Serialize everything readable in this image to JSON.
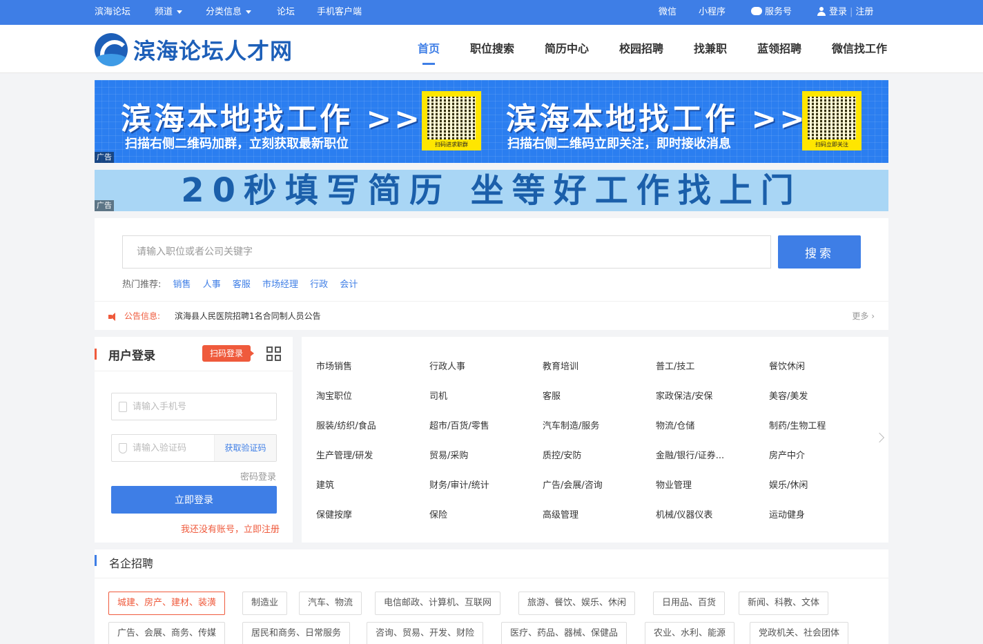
{
  "topbar": {
    "left": [
      "滨海论坛",
      "频道",
      "分类信息",
      "论坛",
      "手机客户端"
    ],
    "wechat": "微信",
    "miniprogram": "小程序",
    "service": "服务号",
    "login": "登录",
    "separator": "|",
    "register": "注册"
  },
  "header": {
    "logo_text": "滨海论坛人才网",
    "nav": [
      "首页",
      "职位搜索",
      "简历中心",
      "校园招聘",
      "找兼职",
      "蓝领招聘",
      "微信找工作"
    ],
    "active_nav": "首页"
  },
  "banner1": {
    "left_title": "滨海本地找工作 >>>",
    "left_sub": "扫描右侧二维码加群，立刻获取最新职位",
    "left_qr_caption": "扫码进求职群",
    "right_title": "滨海本地找工作 >>>",
    "right_sub": "扫描右侧二维码立即关注，即时接收消息",
    "right_qr_caption": "扫码立即关注",
    "ad_tag": "广告"
  },
  "banner2": {
    "text": "20秒填写简历  坐等好工作找上门",
    "ad_tag": "广告"
  },
  "search": {
    "placeholder": "请输入职位或者公司关键字",
    "button": "搜索",
    "hot_label": "热门推荐:",
    "hot": [
      "销售",
      "人事",
      "客服",
      "市场经理",
      "行政",
      "会计"
    ]
  },
  "notice": {
    "label": "公告信息:",
    "text": "滨海县人民医院招聘1名合同制人员公告",
    "more": "更多 ›"
  },
  "login": {
    "title": "用户登录",
    "scan": "扫码登录",
    "phone_placeholder": "请输入手机号",
    "code_placeholder": "请输入验证码",
    "get_code": "获取验证码",
    "password_login": "密码登录",
    "submit": "立即登录",
    "register_link": "我还没有账号，立即注册"
  },
  "categories": [
    [
      "市场销售",
      "行政人事",
      "教育培训",
      "普工/技工",
      "餐饮休闲"
    ],
    [
      "淘宝职位",
      "司机",
      "客服",
      "家政保洁/安保",
      "美容/美发"
    ],
    [
      "服装/纺织/食品",
      "超市/百货/零售",
      "汽车制造/服务",
      "物流/仓储",
      "制药/生物工程"
    ],
    [
      "生产管理/研发",
      "贸易/采购",
      "质控/安防",
      "金融/银行/证券...",
      "房产中介"
    ],
    [
      "建筑",
      "财务/审计/统计",
      "广告/会展/咨询",
      "物业管理",
      "娱乐/休闲"
    ],
    [
      "保健按摩",
      "保险",
      "高级管理",
      "机械/仪器仪表",
      "运动健身"
    ]
  ],
  "companies": {
    "title": "名企招聘",
    "row1": [
      "城建、房产、建材、装潢",
      "制造业",
      "汽车、物流",
      "电信邮政、计算机、互联网",
      "旅游、餐饮、娱乐、休闲",
      "日用品、百货",
      "新闻、科教、文体"
    ],
    "row2": [
      "广告、会展、商务、传媒",
      "居民和商务、日常服务",
      "咨询、贸易、开发、财险",
      "医疗、药品、器械、保健品",
      "农业、水利、能源",
      "党政机关、社会团体"
    ],
    "active": "城建、房产、建材、装潢"
  },
  "colors": {
    "primary": "#3e7ee6",
    "accent": "#ef5a3c"
  }
}
